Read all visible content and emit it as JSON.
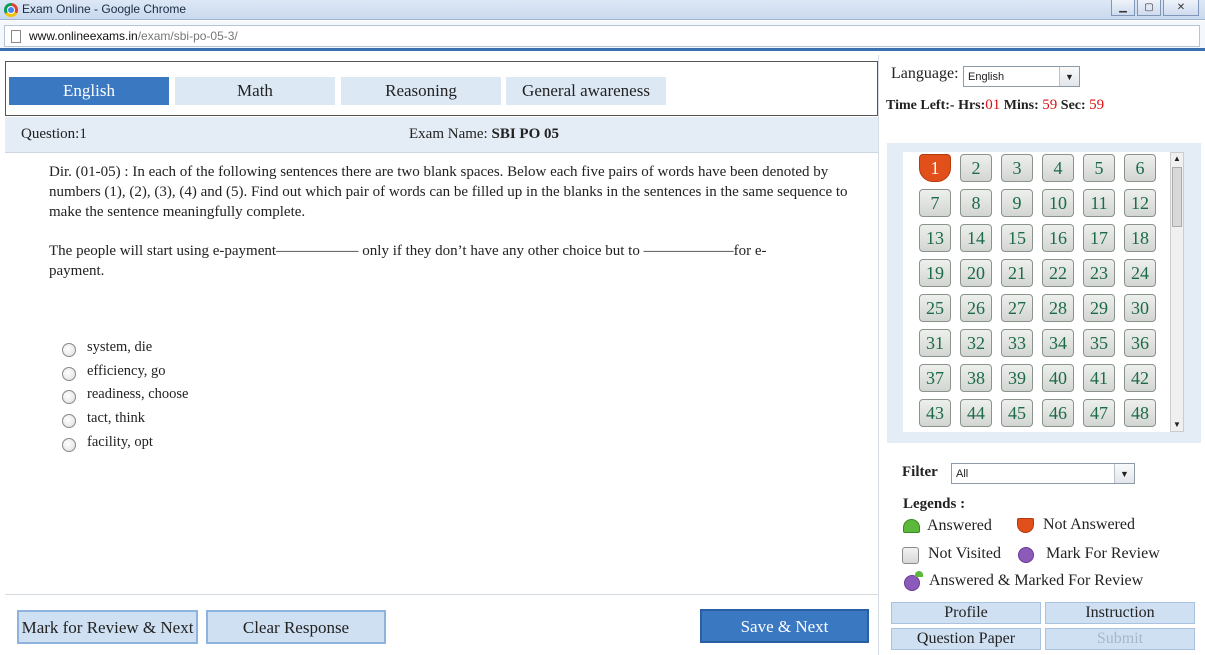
{
  "window": {
    "title": "Exam Online - Google Chrome"
  },
  "browser": {
    "url_host": "www.onlineexams.in",
    "url_path": "/exam/sbi-po-05-3/"
  },
  "tabs": [
    {
      "label": "English",
      "active": true
    },
    {
      "label": "Math",
      "active": false
    },
    {
      "label": "Reasoning",
      "active": false
    },
    {
      "label": "General awareness",
      "active": false
    }
  ],
  "question_header": {
    "question_label": "Question:1",
    "exam_label": "Exam Name:",
    "exam_name": "SBI PO  05"
  },
  "question": {
    "direction": "Dir. (01-05) :  In each of the following sentences there are two blank spaces. Below each five pairs of words have been denoted by numbers (1), (2), (3), (4) and (5). Find out which pair of words can be filled up in the blanks in the sentences in the same sequence to make the sentence meaningfully complete.",
    "sentence": "The people will start using e-payment———–—— only if they don’t have any other choice but to ——————for e-payment."
  },
  "options": [
    {
      "label": "system, die"
    },
    {
      "label": "efficiency, go"
    },
    {
      "label": "readiness, choose"
    },
    {
      "label": "tact, think"
    },
    {
      "label": "facility, opt"
    }
  ],
  "actions": {
    "mark_review": "Mark for Review & Next",
    "clear": "Clear Response",
    "save_next": "Save & Next"
  },
  "language": {
    "label": "Language:",
    "selected": "English"
  },
  "timer": {
    "label": "Time Left:-",
    "hrs_label": "Hrs:",
    "hrs": "01",
    "mins_label": "Mins:",
    "mins": "59",
    "sec_label": "Sec:",
    "sec": "59"
  },
  "palette": {
    "current": 1,
    "questions": [
      "1",
      "2",
      "3",
      "4",
      "5",
      "6",
      "7",
      "8",
      "9",
      "10",
      "11",
      "12",
      "13",
      "14",
      "15",
      "16",
      "17",
      "18",
      "19",
      "20",
      "21",
      "22",
      "23",
      "24",
      "25",
      "26",
      "27",
      "28",
      "29",
      "30",
      "31",
      "32",
      "33",
      "34",
      "35",
      "36",
      "37",
      "38",
      "39",
      "40",
      "41",
      "42",
      "43",
      "44",
      "45",
      "46",
      "47",
      "48"
    ]
  },
  "filter": {
    "label": "Filter",
    "selected": "All"
  },
  "legends": {
    "title": "Legends :",
    "answered": "Answered",
    "not_answered": "Not Answered",
    "not_visited": "Not Visited",
    "mark_review": "Mark For Review",
    "answered_marked": "Answered & Marked For Review"
  },
  "side_buttons": {
    "profile": "Profile",
    "instruction": "Instruction",
    "question_paper": "Question Paper",
    "submit": "Submit"
  },
  "colors": {
    "accent": "#3a78c2",
    "not_answered": "#e1501b",
    "answered": "#5cb83a",
    "review": "#8c5ab8",
    "timer": "#dd1111"
  }
}
